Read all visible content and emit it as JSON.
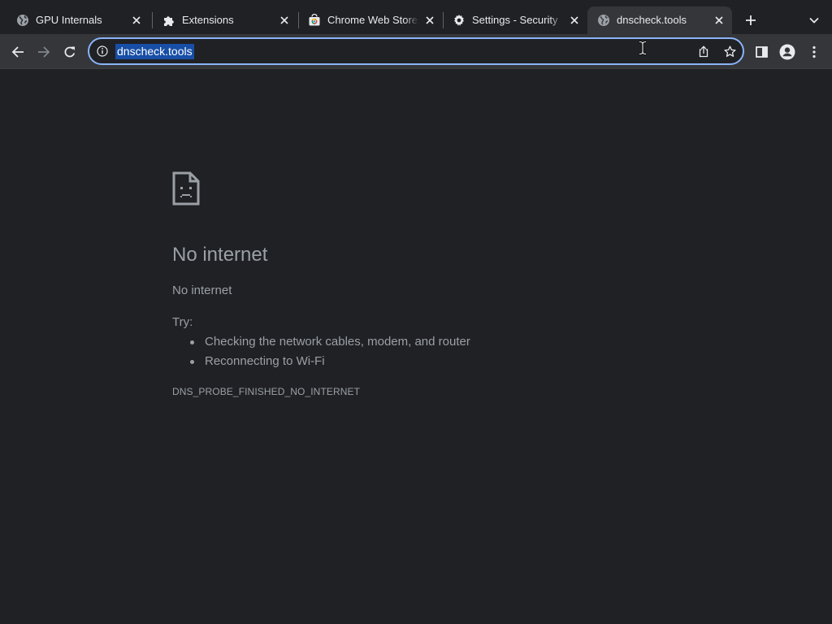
{
  "tabs": [
    {
      "title": "GPU Internals",
      "icon": "globe-icon"
    },
    {
      "title": "Extensions",
      "icon": "puzzle-icon"
    },
    {
      "title": "Chrome Web Store",
      "icon": "chrome-web-store-icon"
    },
    {
      "title": "Settings - Security",
      "icon": "gear-icon"
    },
    {
      "title": "dnscheck.tools",
      "icon": "globe-icon",
      "active": true
    }
  ],
  "omnibox": {
    "url": "dnscheck.tools"
  },
  "error_page": {
    "heading": "No internet",
    "subheading": "No internet",
    "try_label": "Try:",
    "suggestions": [
      "Checking the network cables, modem, and router",
      "Reconnecting to Wi-Fi"
    ],
    "error_code": "DNS_PROBE_FINISHED_NO_INTERNET"
  },
  "colors": {
    "frame": "#202124",
    "toolbar": "#35363a",
    "focus_ring": "#8ab4f8",
    "selection": "#174ea6",
    "error_text": "#9aa0a6"
  }
}
